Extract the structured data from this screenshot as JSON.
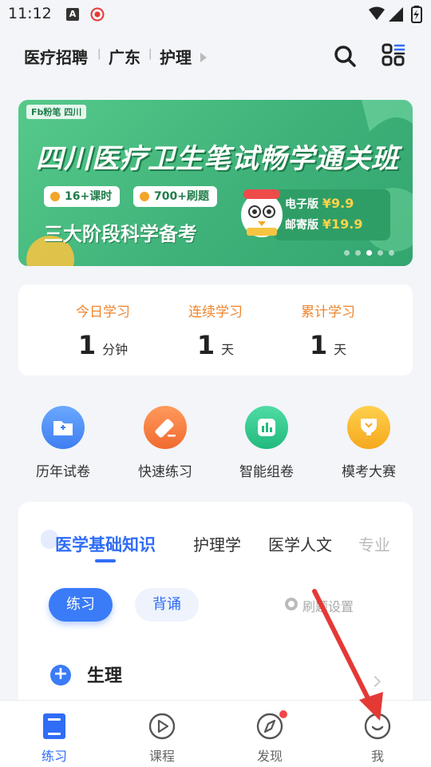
{
  "status_bar": {
    "time": "11:12",
    "a_badge": "A"
  },
  "top_nav": {
    "crumbs": [
      "医疗招聘",
      "广东",
      "护理"
    ],
    "separator": "|"
  },
  "banner": {
    "logo": "Fb粉笔 四川",
    "title": "四川医疗卫生笔试畅学通关班",
    "pills": [
      "16+课时",
      "700+刷题"
    ],
    "subtitle": "三大阶段科学备考",
    "prices": [
      {
        "label": "电子版",
        "price": "¥9.9"
      },
      {
        "label": "邮寄版",
        "price": "¥19.9"
      }
    ],
    "dots_count": 5,
    "active_dot": 2
  },
  "study_stats": [
    {
      "label": "今日学习",
      "value": "1",
      "unit": "分钟"
    },
    {
      "label": "连续学习",
      "value": "1",
      "unit": "天"
    },
    {
      "label": "累计学习",
      "value": "1",
      "unit": "天"
    }
  ],
  "tools": [
    {
      "label": "历年试卷",
      "icon": "folder-plus-icon",
      "color": "#4d8ff7"
    },
    {
      "label": "快速练习",
      "icon": "pencil-icon",
      "color": "#f7793a"
    },
    {
      "label": "智能组卷",
      "icon": "chart-bars-icon",
      "color": "#2fc88e"
    },
    {
      "label": "模考大赛",
      "icon": "trophy-icon",
      "color": "#f6b820"
    }
  ],
  "subject": {
    "tabs": [
      "医学基础知识",
      "护理学",
      "医学人文",
      "专业"
    ],
    "active_tab": 0,
    "modes": [
      "练习",
      "背诵"
    ],
    "settings_label": "刷题设置",
    "category": "生理"
  },
  "bottom_tabs": [
    {
      "label": "练习",
      "icon": "book-icon",
      "active": true
    },
    {
      "label": "课程",
      "icon": "play-circle-icon",
      "active": false
    },
    {
      "label": "发现",
      "icon": "compass-icon",
      "active": false,
      "badge": true
    },
    {
      "label": "我",
      "icon": "profile-icon",
      "active": false
    }
  ],
  "colors": {
    "accent": "#2f6df6",
    "stat_label": "#f0842c",
    "banner_green": "#3fb27a",
    "annotation": "#e53935"
  }
}
